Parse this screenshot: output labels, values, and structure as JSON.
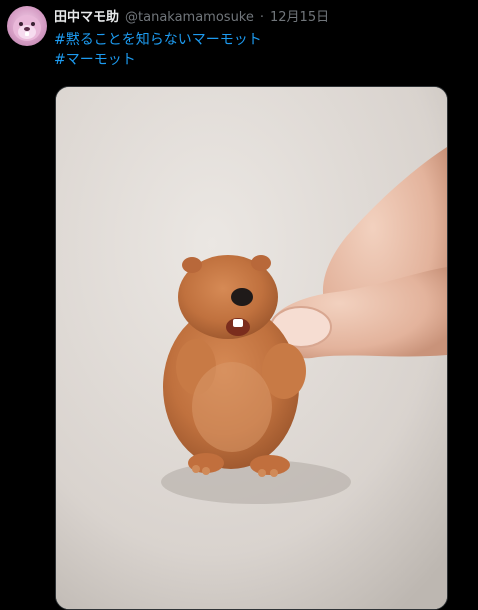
{
  "tweet": {
    "author_name": "田中マモ助",
    "author_handle": "@tanakamamosuke",
    "separator": "·",
    "date": "12月15日",
    "hashtags": [
      "#黙ることを知らないマーモット",
      "#マーモット"
    ]
  },
  "icons": {
    "avatar": "marmot-avatar-icon"
  },
  "colors": {
    "background": "#000000",
    "text": "#e7e9ea",
    "muted": "#71767b",
    "link": "#1d9bf0"
  },
  "media": {
    "type": "photo",
    "subject": "marmot-figure"
  }
}
